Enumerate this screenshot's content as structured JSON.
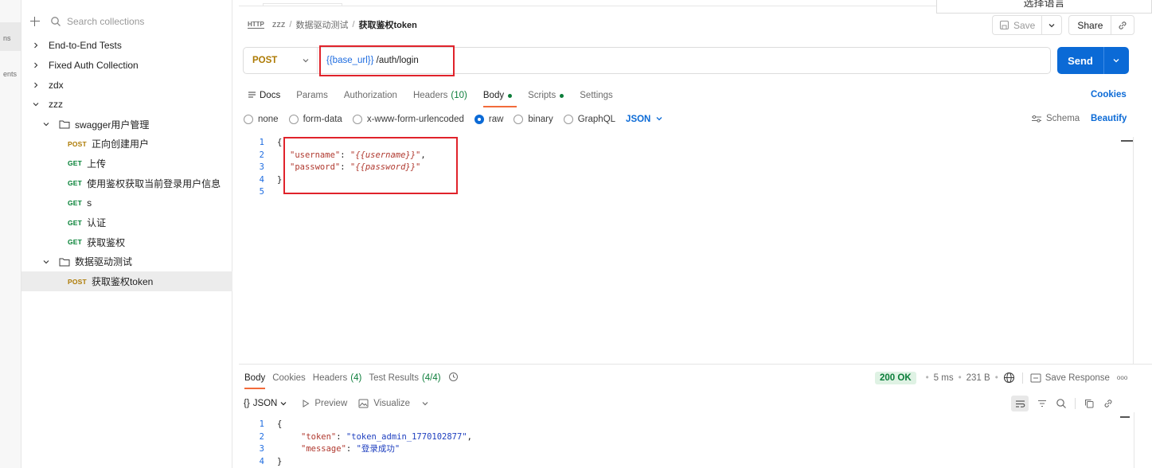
{
  "rail": {
    "labels": [
      "ns",
      "ents"
    ]
  },
  "language_popup": {
    "label": "选择语言"
  },
  "sidebar": {
    "search_placeholder": "Search collections",
    "tree": [
      {
        "kind": "collection",
        "label": "End-to-End Tests",
        "expanded": false,
        "depth": 0
      },
      {
        "kind": "collection",
        "label": "Fixed Auth Collection",
        "expanded": false,
        "depth": 0
      },
      {
        "kind": "collection",
        "label": "zdx",
        "expanded": false,
        "depth": 0
      },
      {
        "kind": "collection",
        "label": "zzz",
        "expanded": true,
        "depth": 0
      },
      {
        "kind": "folder",
        "label": "swagger用户管理",
        "expanded": true,
        "depth": 1
      },
      {
        "kind": "request",
        "method": "POST",
        "label": "正向创建用户",
        "depth": 2
      },
      {
        "kind": "request",
        "method": "GET",
        "label": "上传",
        "depth": 2
      },
      {
        "kind": "request",
        "method": "GET",
        "label": "使用鉴权获取当前登录用户信息",
        "depth": 2
      },
      {
        "kind": "request",
        "method": "GET",
        "label": "s",
        "depth": 2
      },
      {
        "kind": "request",
        "method": "GET",
        "label": "认证",
        "depth": 2
      },
      {
        "kind": "request",
        "method": "GET",
        "label": "获取鉴权",
        "depth": 2
      },
      {
        "kind": "folder",
        "label": "数据驱动测试",
        "expanded": true,
        "depth": 1
      },
      {
        "kind": "request",
        "method": "POST",
        "label": "获取鉴权token",
        "depth": 2,
        "selected": true
      }
    ]
  },
  "breadcrumb": {
    "icon_text": "HTTP",
    "parts": [
      "zzz",
      "数据驱动测试"
    ],
    "current": "获取鉴权token"
  },
  "header_actions": {
    "save_label": "Save",
    "share_label": "Share"
  },
  "request": {
    "method": "POST",
    "url_var": "{{base_url}}",
    "url_path": " /auth/login",
    "send_label": "Send",
    "tabs": [
      {
        "label": "Docs"
      },
      {
        "label": "Params"
      },
      {
        "label": "Authorization"
      },
      {
        "label": "Headers",
        "count": "(10)"
      },
      {
        "label": "Body",
        "active": true,
        "dot": true
      },
      {
        "label": "Scripts",
        "dot": true
      },
      {
        "label": "Settings"
      }
    ],
    "cookies_label": "Cookies",
    "body_modes": [
      "none",
      "form-data",
      "x-www-form-urlencoded",
      "raw",
      "binary",
      "GraphQL"
    ],
    "body_mode_selected": "raw",
    "body_format": "JSON",
    "schema_label": "Schema",
    "beautify_label": "Beautify",
    "body_lines": [
      {
        "n": "1",
        "text": "{"
      },
      {
        "n": "2",
        "key": "\"username\"",
        "val": "\"{{username}}\"",
        "tail": ","
      },
      {
        "n": "3",
        "key": "\"password\"",
        "val": "\"{{password}}\"",
        "tail": ""
      },
      {
        "n": "4",
        "text": "}"
      },
      {
        "n": "5",
        "text": ""
      }
    ]
  },
  "response": {
    "tabs": [
      {
        "label": "Body",
        "active": true
      },
      {
        "label": "Cookies"
      },
      {
        "label": "Headers",
        "count": "(4)"
      },
      {
        "label": "Test Results",
        "count": "(4/4)"
      }
    ],
    "status": "200 OK",
    "time": "5 ms",
    "size": "231 B",
    "save_label": "Save Response",
    "more": "ooo",
    "format": "JSON",
    "preview_label": "Preview",
    "visualize_label": "Visualize",
    "lines": [
      {
        "n": "1",
        "text": "{"
      },
      {
        "n": "2",
        "key": "\"token\"",
        "val": "\"token_admin_1770102877\"",
        "tail": ","
      },
      {
        "n": "3",
        "key": "\"message\"",
        "val": "\"登录成功\"",
        "tail": ""
      },
      {
        "n": "4",
        "text": "}"
      }
    ]
  },
  "colors": {
    "accent": "#0b6ad6",
    "post": "#ad7a03",
    "get": "#007f31",
    "highlight": "#e0232b",
    "tab_active": "#f26b3a"
  }
}
